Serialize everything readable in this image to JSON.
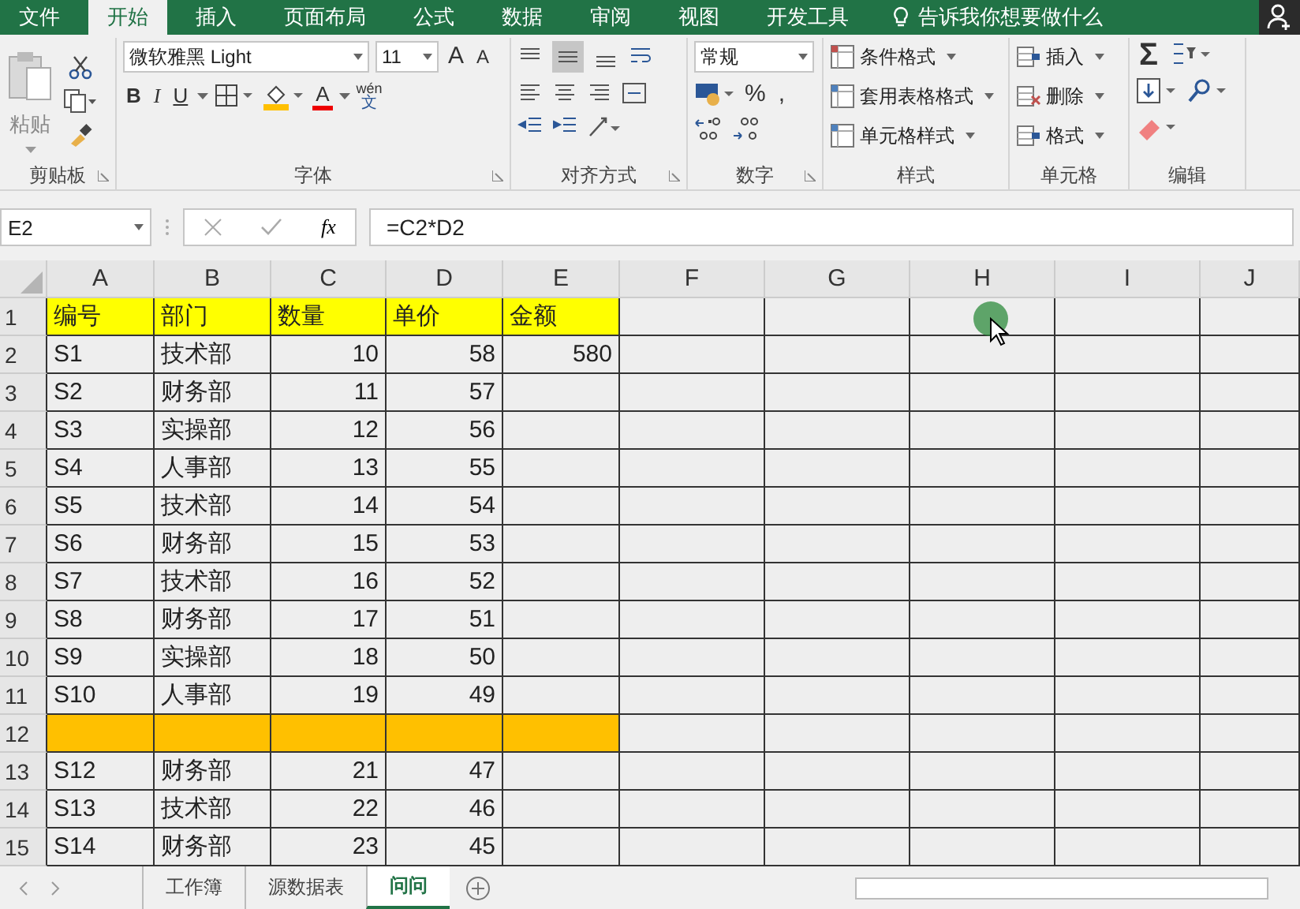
{
  "ribbon_tabs": [
    {
      "label": "文件",
      "selected": false
    },
    {
      "label": "开始",
      "selected": true
    },
    {
      "label": "插入",
      "selected": false
    },
    {
      "label": "页面布局",
      "selected": false
    },
    {
      "label": "公式",
      "selected": false
    },
    {
      "label": "数据",
      "selected": false
    },
    {
      "label": "审阅",
      "selected": false
    },
    {
      "label": "视图",
      "selected": false
    },
    {
      "label": "开发工具",
      "selected": false
    }
  ],
  "tell_me": "告诉我你想要做什么",
  "ribbon": {
    "clipboard": {
      "paste": "粘贴",
      "group": "剪贴板"
    },
    "font": {
      "name": "微软雅黑 Light",
      "size": "11",
      "grow": "A",
      "shrink": "A",
      "bold": "B",
      "italic": "I",
      "underline": "U",
      "font_color": "A",
      "phonetic_top": "wén",
      "phonetic_bottom": "文",
      "group": "字体"
    },
    "alignment": {
      "group": "对齐方式"
    },
    "number": {
      "format": "常规",
      "percent": "%",
      "comma": ",",
      "group": "数字"
    },
    "styles": {
      "items": [
        "条件格式",
        "套用表格格式",
        "单元格样式"
      ],
      "group": "样式"
    },
    "cells": {
      "items": [
        "插入",
        "删除",
        "格式"
      ],
      "group": "单元格"
    },
    "editing": {
      "sum": "Σ",
      "group": "编辑"
    }
  },
  "formula_bar": {
    "name_box": "E2",
    "fx": "fx",
    "formula": "=C2*D2"
  },
  "columns": [
    "A",
    "B",
    "C",
    "D",
    "E",
    "F",
    "G",
    "H",
    "I",
    "J"
  ],
  "rows": [
    {
      "number": "1",
      "color": "#ffff00",
      "cells": [
        "编号",
        "部门",
        "数量",
        "单价",
        "金额"
      ]
    },
    {
      "number": "2",
      "cells": [
        "S1",
        "技术部",
        "10",
        "58",
        "580"
      ]
    },
    {
      "number": "3",
      "cells": [
        "S2",
        "财务部",
        "11",
        "57"
      ]
    },
    {
      "number": "4",
      "cells": [
        "S3",
        "实操部",
        "12",
        "56"
      ]
    },
    {
      "number": "5",
      "cells": [
        "S4",
        "人事部",
        "13",
        "55"
      ]
    },
    {
      "number": "6",
      "cells": [
        "S5",
        "技术部",
        "14",
        "54"
      ]
    },
    {
      "number": "7",
      "cells": [
        "S6",
        "财务部",
        "15",
        "53"
      ]
    },
    {
      "number": "8",
      "cells": [
        "S7",
        "技术部",
        "16",
        "52"
      ]
    },
    {
      "number": "9",
      "cells": [
        "S8",
        "财务部",
        "17",
        "51"
      ]
    },
    {
      "number": "10",
      "cells": [
        "S9",
        "实操部",
        "18",
        "50"
      ]
    },
    {
      "number": "11",
      "cells": [
        "S10",
        "人事部",
        "19",
        "49"
      ]
    },
    {
      "number": "12",
      "color": "#ffc000",
      "cells": []
    },
    {
      "number": "13",
      "cells": [
        "S12",
        "财务部",
        "21",
        "47"
      ]
    },
    {
      "number": "14",
      "cells": [
        "S13",
        "技术部",
        "22",
        "46"
      ]
    },
    {
      "number": "15",
      "cells": [
        "S14",
        "财务部",
        "23",
        "45"
      ]
    }
  ],
  "sheet_tabs": [
    {
      "label": "工作簿",
      "selected": false
    },
    {
      "label": "源数据表",
      "selected": false
    },
    {
      "label": "问问",
      "selected": true
    }
  ]
}
